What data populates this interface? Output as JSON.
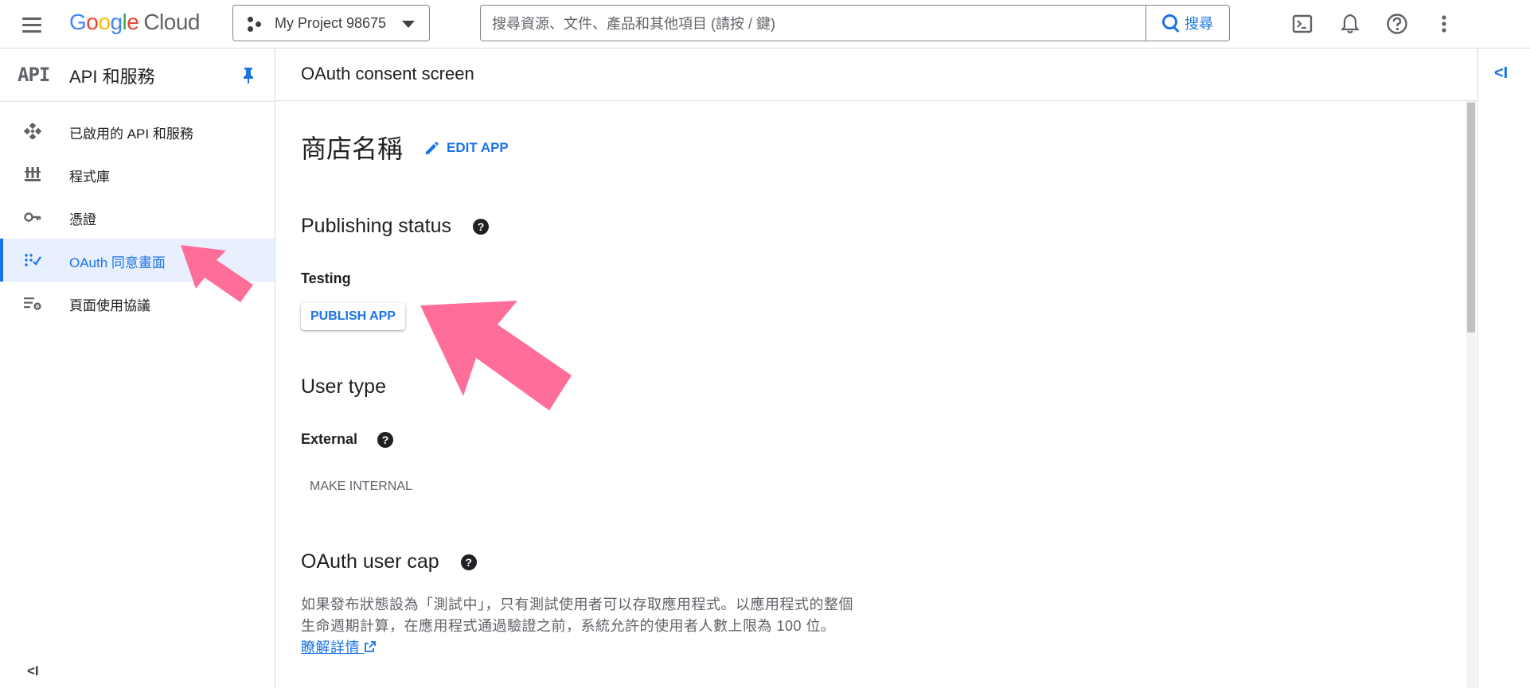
{
  "header": {
    "logo_google": "Google",
    "logo_cloud": "Cloud",
    "project_name": "My Project 98675",
    "search_placeholder": "搜尋資源、文件、產品和其他項目 (請按 / 鍵)",
    "search_button": "搜尋",
    "icons": [
      "menu-icon",
      "project-dots-icon",
      "search-icon",
      "terminal-icon",
      "bell-icon",
      "help-icon",
      "more-vert-icon"
    ]
  },
  "sidebar": {
    "logo": "API",
    "title": "API 和服務",
    "items": [
      {
        "label": "已啟用的 API 和服務",
        "icon": "api-dots-icon",
        "active": false
      },
      {
        "label": "程式庫",
        "icon": "library-icon",
        "active": false
      },
      {
        "label": "憑證",
        "icon": "key-icon",
        "active": false
      },
      {
        "label": "OAuth 同意畫面",
        "icon": "oauth-icon",
        "active": true
      },
      {
        "label": "頁面使用協議",
        "icon": "settings-list-icon",
        "active": false
      }
    ],
    "collapse_label": "<I"
  },
  "main": {
    "page_title": "OAuth consent screen",
    "app_name": "商店名稱",
    "edit_app": "EDIT APP",
    "publishing_heading": "Publishing status",
    "publishing_status": "Testing",
    "publish_button": "PUBLISH APP",
    "user_type_heading": "User type",
    "user_type_value": "External",
    "make_internal": "MAKE INTERNAL",
    "user_cap_heading": "OAuth user cap",
    "user_cap_text": "如果發布狀態設為「測試中」，只有測試使用者可以存取應用程式。以應用程式的整個生命週期計算，在應用程式通過驗證之前，系統允許的使用者人數上限為 100 位。",
    "learn_more": "瞭解詳情"
  },
  "right_panel": {
    "toggle_label": "<I"
  },
  "colors": {
    "accent": "#1a73e8",
    "annotation": "#ff6e99",
    "active_bg": "#e8f0fe"
  }
}
